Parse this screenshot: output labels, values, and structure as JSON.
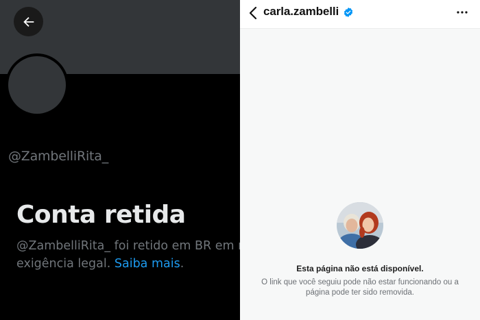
{
  "twitter": {
    "handle": "@ZambelliRita_",
    "withheld_title": "Conta retida",
    "withheld_text_line1": "@ZambelliRita_ foi retido em BR em re",
    "withheld_text_line2_prefix": "exigência legal. ",
    "learn_more_link": "Saiba mais",
    "withheld_text_suffix": ".",
    "link_color": "#1d9bf0"
  },
  "instagram": {
    "username": "carla.zambelli",
    "verified_icon": "verified-badge-icon",
    "unavailable_title": "Esta página não está disponível.",
    "unavailable_subtitle": "O link que você seguiu pode não estar funcionando ou a página pode ter sido removida.",
    "accent_color": "#0095f6"
  }
}
